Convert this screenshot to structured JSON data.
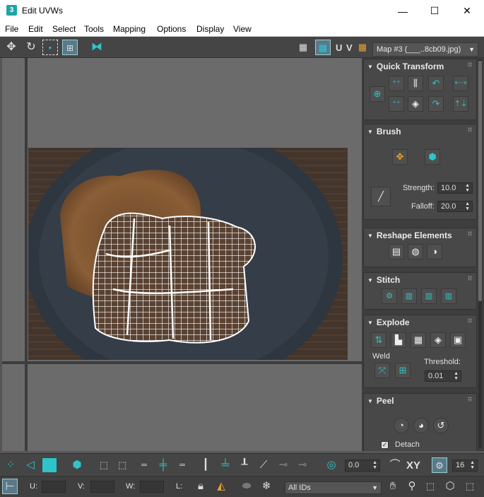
{
  "window": {
    "title": "Edit UVWs",
    "app_icon": "3",
    "minimize": "—",
    "maximize": "☐",
    "close": "✕"
  },
  "menu": [
    "File",
    "Edit",
    "Select",
    "Tools",
    "Mapping",
    "Options",
    "Display",
    "View"
  ],
  "toolbar": {
    "uv_label": "U V",
    "map_select": "Map #3 (___..8cb09.jpg)"
  },
  "panel": {
    "quick_transform": {
      "title": "Quick Transform"
    },
    "brush": {
      "title": "Brush",
      "strength_label": "Strength:",
      "strength_value": "10.0",
      "falloff_label": "Falloff:",
      "falloff_value": "20.0"
    },
    "reshape": {
      "title": "Reshape Elements"
    },
    "stitch": {
      "title": "Stitch"
    },
    "explode": {
      "title": "Explode",
      "weld_label": "Weld",
      "threshold_label": "Threshold:",
      "threshold_value": "0.01"
    },
    "peel": {
      "title": "Peel",
      "detach_label": "Detach"
    }
  },
  "bottom": {
    "angle_value": "0.0",
    "xy_label": "XY",
    "count_value": "16",
    "u_label": "U:",
    "v_label": "V:",
    "w_label": "W:",
    "l_label": "L:",
    "ids_select": "All IDs"
  },
  "colors": {
    "accent": "#2ec4c9",
    "panel": "#3e3e3e",
    "viewport": "#6b6b6b"
  }
}
